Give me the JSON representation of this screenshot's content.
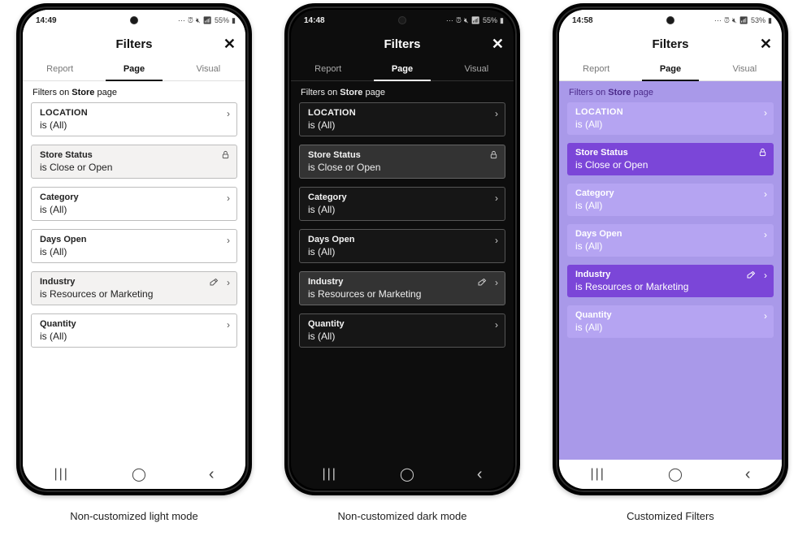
{
  "phones": [
    {
      "id": "light",
      "mode_class": "light",
      "caption": "Non-customized light mode",
      "status": {
        "time": "14:49",
        "battery": "55%"
      },
      "title": "Filters"
    },
    {
      "id": "dark",
      "mode_class": "dark",
      "caption": "Non-customized dark mode",
      "status": {
        "time": "14:48",
        "battery": "55%"
      },
      "title": "Filters"
    },
    {
      "id": "purple",
      "mode_class": "purple",
      "caption": "Customized Filters",
      "status": {
        "time": "14:58",
        "battery": "53%"
      },
      "title": "Filters"
    }
  ],
  "tabs": {
    "report": "Report",
    "page": "Page",
    "visual": "Visual",
    "active": "page"
  },
  "section": {
    "prefix": "Filters on ",
    "bold": "Store",
    "suffix": " page"
  },
  "cards": [
    {
      "title": "LOCATION",
      "upper": true,
      "value": "is (All)",
      "alt": false,
      "icons": [
        "chev"
      ]
    },
    {
      "title": "Store Status",
      "upper": false,
      "value": "is Close or Open",
      "alt": true,
      "icons": [
        "lock"
      ]
    },
    {
      "title": "Category",
      "upper": false,
      "value": "is (All)",
      "alt": false,
      "icons": [
        "chev"
      ]
    },
    {
      "title": "Days Open",
      "upper": false,
      "value": "is (All)",
      "alt": false,
      "icons": [
        "chev"
      ]
    },
    {
      "title": "Industry",
      "upper": false,
      "value": "is Resources or Marketing",
      "alt": true,
      "icons": [
        "eraser",
        "chev"
      ]
    },
    {
      "title": "Quantity",
      "upper": false,
      "value": "is (All)",
      "alt": false,
      "icons": [
        "chev"
      ]
    }
  ],
  "icons": {
    "close_glyph": "✕",
    "chev_glyph": "›",
    "lock_glyph": "🔒︎",
    "nav_recent": "|||",
    "nav_home": "◯",
    "nav_back": "‹"
  }
}
